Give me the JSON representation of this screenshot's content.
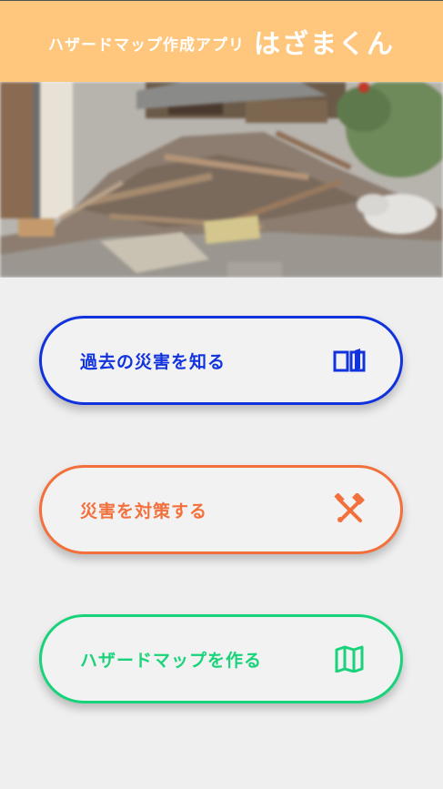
{
  "header": {
    "subtitle": "ハザードマップ作成アプリ",
    "title": "はざまくん",
    "background_color": "#ffc77e"
  },
  "hero": {
    "image": "blurred disaster rubble photo"
  },
  "menu": [
    {
      "label": "過去の災害を知る",
      "icon": "book-icon",
      "color": "#1133dd"
    },
    {
      "label": "災害を対策する",
      "icon": "tools-icon",
      "color": "#f2703c"
    },
    {
      "label": "ハザードマップを作る",
      "icon": "map-icon",
      "color": "#19d37a"
    }
  ]
}
